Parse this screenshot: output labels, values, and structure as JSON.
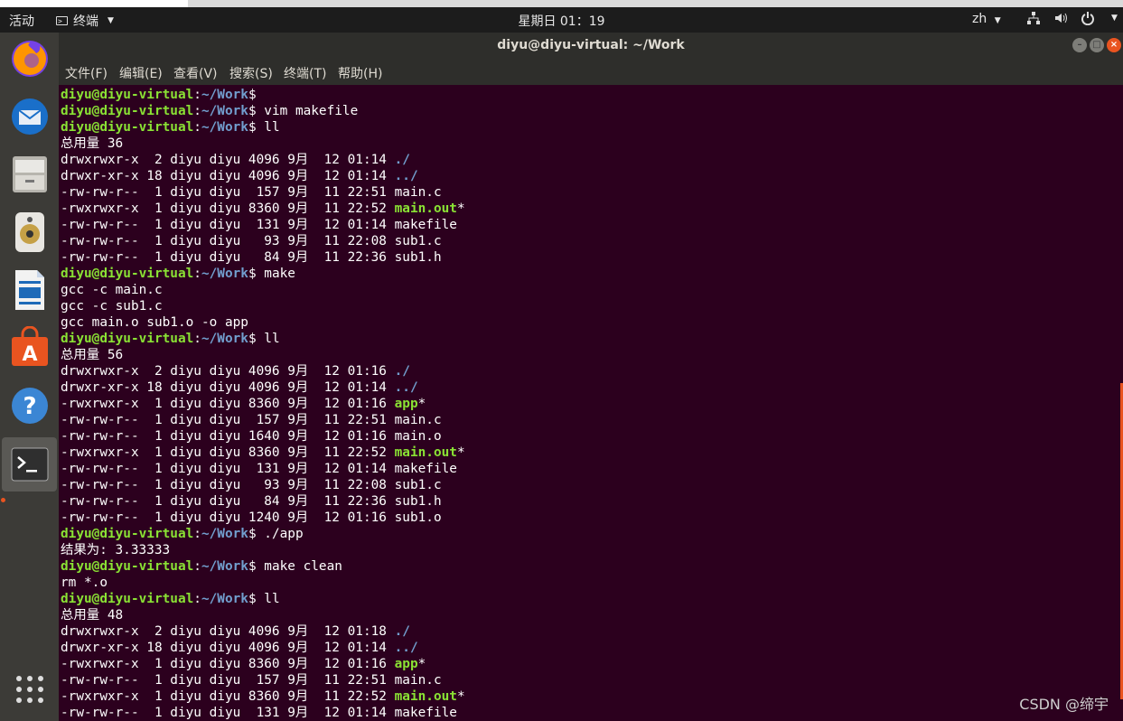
{
  "topbar": {
    "activities": "活动",
    "app_menu": "终端",
    "clock": "星期日 01：19",
    "input_method": "zh"
  },
  "dock": {
    "apps": [
      {
        "name": "firefox-icon"
      },
      {
        "name": "thunderbird-icon"
      },
      {
        "name": "files-icon"
      },
      {
        "name": "rhythmbox-icon"
      },
      {
        "name": "writer-icon"
      },
      {
        "name": "software-icon"
      },
      {
        "name": "help-icon"
      },
      {
        "name": "terminal-icon"
      }
    ]
  },
  "window": {
    "title": "diyu@diyu-virtual: ~/Work",
    "menu": [
      "文件(F)",
      "编辑(E)",
      "查看(V)",
      "搜索(S)",
      "终端(T)",
      "帮助(H)"
    ]
  },
  "terminal": {
    "prompt_user": "diyu@diyu-virtual",
    "prompt_path": "~/Work",
    "lines": [
      {
        "kind": "prompt",
        "cmd": ""
      },
      {
        "kind": "prompt",
        "cmd": " vim makefile"
      },
      {
        "kind": "prompt",
        "cmd": " ll"
      },
      {
        "kind": "text",
        "text": "总用量 36"
      },
      {
        "kind": "ls",
        "pre": "drwxrwxr-x  2 diyu diyu 4096 9月  12 01:14 ",
        "name": "./",
        "type": "dir",
        "suffix": ""
      },
      {
        "kind": "ls",
        "pre": "drwxr-xr-x 18 diyu diyu 4096 9月  12 01:14 ",
        "name": "../",
        "type": "dir",
        "suffix": ""
      },
      {
        "kind": "ls",
        "pre": "-rw-rw-r--  1 diyu diyu  157 9月  11 22:51 ",
        "name": "main.c",
        "type": "file",
        "suffix": ""
      },
      {
        "kind": "ls",
        "pre": "-rwxrwxr-x  1 diyu diyu 8360 9月  11 22:52 ",
        "name": "main.out",
        "type": "exe",
        "suffix": "*"
      },
      {
        "kind": "ls",
        "pre": "-rw-rw-r--  1 diyu diyu  131 9月  12 01:14 ",
        "name": "makefile",
        "type": "file",
        "suffix": ""
      },
      {
        "kind": "ls",
        "pre": "-rw-rw-r--  1 diyu diyu   93 9月  11 22:08 ",
        "name": "sub1.c",
        "type": "file",
        "suffix": ""
      },
      {
        "kind": "ls",
        "pre": "-rw-rw-r--  1 diyu diyu   84 9月  11 22:36 ",
        "name": "sub1.h",
        "type": "file",
        "suffix": ""
      },
      {
        "kind": "prompt",
        "cmd": " make"
      },
      {
        "kind": "text",
        "text": "gcc -c main.c"
      },
      {
        "kind": "text",
        "text": "gcc -c sub1.c"
      },
      {
        "kind": "text",
        "text": "gcc main.o sub1.o -o app"
      },
      {
        "kind": "prompt",
        "cmd": " ll"
      },
      {
        "kind": "text",
        "text": "总用量 56"
      },
      {
        "kind": "ls",
        "pre": "drwxrwxr-x  2 diyu diyu 4096 9月  12 01:16 ",
        "name": "./",
        "type": "dir",
        "suffix": ""
      },
      {
        "kind": "ls",
        "pre": "drwxr-xr-x 18 diyu diyu 4096 9月  12 01:14 ",
        "name": "../",
        "type": "dir",
        "suffix": ""
      },
      {
        "kind": "ls",
        "pre": "-rwxrwxr-x  1 diyu diyu 8360 9月  12 01:16 ",
        "name": "app",
        "type": "exe",
        "suffix": "*"
      },
      {
        "kind": "ls",
        "pre": "-rw-rw-r--  1 diyu diyu  157 9月  11 22:51 ",
        "name": "main.c",
        "type": "file",
        "suffix": ""
      },
      {
        "kind": "ls",
        "pre": "-rw-rw-r--  1 diyu diyu 1640 9月  12 01:16 ",
        "name": "main.o",
        "type": "file",
        "suffix": ""
      },
      {
        "kind": "ls",
        "pre": "-rwxrwxr-x  1 diyu diyu 8360 9月  11 22:52 ",
        "name": "main.out",
        "type": "exe",
        "suffix": "*"
      },
      {
        "kind": "ls",
        "pre": "-rw-rw-r--  1 diyu diyu  131 9月  12 01:14 ",
        "name": "makefile",
        "type": "file",
        "suffix": ""
      },
      {
        "kind": "ls",
        "pre": "-rw-rw-r--  1 diyu diyu   93 9月  11 22:08 ",
        "name": "sub1.c",
        "type": "file",
        "suffix": ""
      },
      {
        "kind": "ls",
        "pre": "-rw-rw-r--  1 diyu diyu   84 9月  11 22:36 ",
        "name": "sub1.h",
        "type": "file",
        "suffix": ""
      },
      {
        "kind": "ls",
        "pre": "-rw-rw-r--  1 diyu diyu 1240 9月  12 01:16 ",
        "name": "sub1.o",
        "type": "file",
        "suffix": ""
      },
      {
        "kind": "prompt",
        "cmd": " ./app"
      },
      {
        "kind": "text",
        "text": "结果为: 3.33333"
      },
      {
        "kind": "prompt",
        "cmd": " make clean"
      },
      {
        "kind": "text",
        "text": "rm *.o"
      },
      {
        "kind": "prompt",
        "cmd": " ll"
      },
      {
        "kind": "text",
        "text": "总用量 48"
      },
      {
        "kind": "ls",
        "pre": "drwxrwxr-x  2 diyu diyu 4096 9月  12 01:18 ",
        "name": "./",
        "type": "dir",
        "suffix": ""
      },
      {
        "kind": "ls",
        "pre": "drwxr-xr-x 18 diyu diyu 4096 9月  12 01:14 ",
        "name": "../",
        "type": "dir",
        "suffix": ""
      },
      {
        "kind": "ls",
        "pre": "-rwxrwxr-x  1 diyu diyu 8360 9月  12 01:16 ",
        "name": "app",
        "type": "exe",
        "suffix": "*"
      },
      {
        "kind": "ls",
        "pre": "-rw-rw-r--  1 diyu diyu  157 9月  11 22:51 ",
        "name": "main.c",
        "type": "file",
        "suffix": ""
      },
      {
        "kind": "ls",
        "pre": "-rwxrwxr-x  1 diyu diyu 8360 9月  11 22:52 ",
        "name": "main.out",
        "type": "exe",
        "suffix": "*"
      },
      {
        "kind": "ls",
        "pre": "-rw-rw-r--  1 diyu diyu  131 9月  12 01:14 ",
        "name": "makefile",
        "type": "file",
        "suffix": ""
      }
    ]
  },
  "watermark": "CSDN @缔宇",
  "colors": {
    "terminal_bg": "#2c001e",
    "prompt_user": "#8ae234",
    "prompt_path": "#729fcf",
    "accent": "#e95420"
  }
}
